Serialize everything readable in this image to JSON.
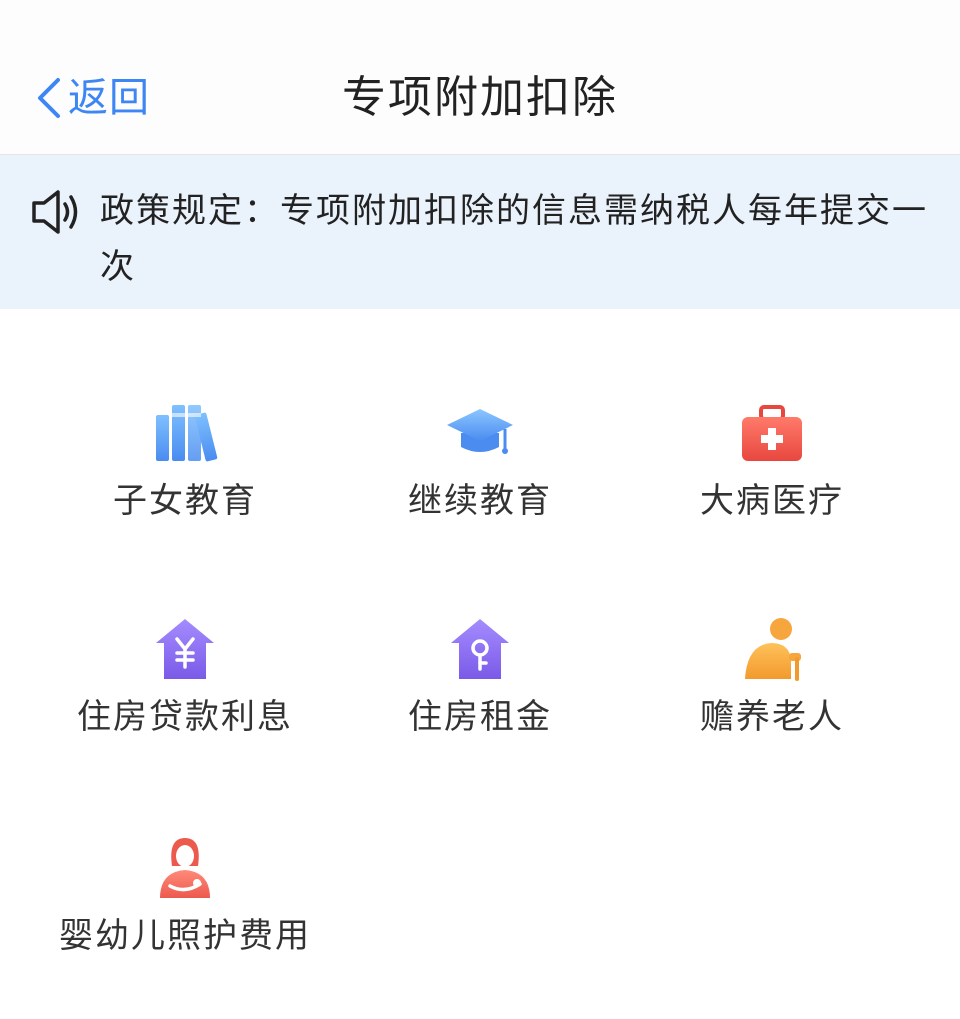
{
  "header": {
    "back_label": "返回",
    "title": "专项附加扣除"
  },
  "notice": {
    "icon": "speaker-icon",
    "text": "政策规定：专项附加扣除的信息需纳税人每年提交一次"
  },
  "colors": {
    "accent": "#3d86f4",
    "notice_bg": "#eaf2fc",
    "education_blue": "#5aa0f2",
    "medical_red": "#f0605a",
    "housing_purple": "#8b6cf0",
    "elderly_orange": "#f6a63c",
    "infant_red": "#f06a5e"
  },
  "items": [
    {
      "label": "子女教育",
      "icon": "books-icon"
    },
    {
      "label": "继续教育",
      "icon": "graduation-cap-icon"
    },
    {
      "label": "大病医疗",
      "icon": "medical-kit-icon"
    },
    {
      "label": "住房贷款利息",
      "icon": "house-yuan-icon"
    },
    {
      "label": "住房租金",
      "icon": "house-key-icon"
    },
    {
      "label": "赡养老人",
      "icon": "elderly-person-icon"
    },
    {
      "label": "婴幼儿照护费用",
      "icon": "mother-baby-icon"
    }
  ]
}
